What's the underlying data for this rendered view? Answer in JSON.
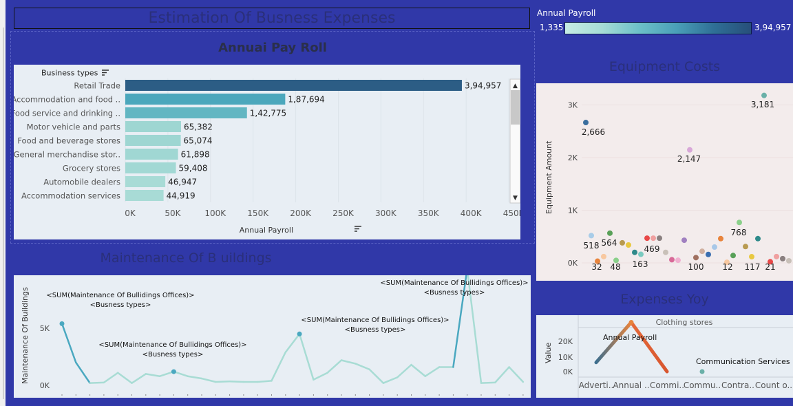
{
  "dashboard": {
    "title": "Estimation Of Busness Expenses"
  },
  "legend": {
    "title": "Annual Payroll",
    "min": "1,335",
    "max": "3,94,957"
  },
  "payroll": {
    "title": "Annuai Pay Roll",
    "row_header": "Business types",
    "axis_title": "Annual Payroll",
    "ticks": [
      "0K",
      "50K",
      "100K",
      "150K",
      "200K",
      "250K",
      "300K",
      "350K",
      "400K",
      "450K"
    ],
    "rows": [
      {
        "label": "Retail Trade",
        "value": 394957,
        "text": "3,94,957",
        "color": "#2c5d85"
      },
      {
        "label": "Accommodation and food ..",
        "value": 187694,
        "text": "1,87,694",
        "color": "#4ba7bc"
      },
      {
        "label": "Food service and drinking ..",
        "value": 142775,
        "text": "1,42,775",
        "color": "#62b6c2"
      },
      {
        "label": "Motor vehicle and parts",
        "value": 65382,
        "text": "65,382",
        "color": "#9ed6d2"
      },
      {
        "label": "Food and beverage stores",
        "value": 65074,
        "text": "65,074",
        "color": "#9ed6d2"
      },
      {
        "label": "General merchandise stor..",
        "value": 61898,
        "text": "61,898",
        "color": "#a0d7d3"
      },
      {
        "label": "Grocery stores",
        "value": 59408,
        "text": "59,408",
        "color": "#a2d8d4"
      },
      {
        "label": "Automobile dealers",
        "value": 46947,
        "text": "46,947",
        "color": "#a8dbd6"
      },
      {
        "label": "Accommodation services",
        "value": 44919,
        "text": "44,919",
        "color": "#a8dbd6"
      }
    ]
  },
  "maintenance": {
    "title": "Maintenance Of B uildings",
    "ylabel": "Maintenance Of Buildings",
    "yticks": [
      "5K",
      "0K"
    ],
    "annotation_line1": "<SUM(Maintenance Of Bullidings Offices)>",
    "annotation_line2": "<Busness types>"
  },
  "equipment": {
    "title": "Equipment Costs",
    "ylabel": "Equipment Amount",
    "yticks": [
      "3K",
      "2K",
      "1K",
      "0K"
    ],
    "labels": [
      "2,666",
      "3,181",
      "2,147",
      "518",
      "564",
      "469",
      "768",
      "163",
      "32",
      "48",
      "100",
      "12",
      "117",
      "21"
    ]
  },
  "yoy": {
    "title": "Expenses Yoy",
    "header": "Clothing stores",
    "ylabel": "Value",
    "yticks": [
      "20K",
      "10K",
      "0K"
    ],
    "categories": [
      "Adverti..",
      "Annual ..",
      "Commi..",
      "Commu..",
      "Contra..",
      "Count o.."
    ],
    "annotation_payroll": "Annual Payroll",
    "annotation_comm": "Communication Services"
  },
  "chart_data": [
    {
      "type": "bar",
      "title": "Annuai Pay Roll",
      "xlabel": "Annual Payroll",
      "ylabel": "Business types",
      "categories": [
        "Retail Trade",
        "Accommodation and food ..",
        "Food service and drinking ..",
        "Motor vehicle and parts",
        "Food and beverage stores",
        "General merchandise stor..",
        "Grocery stores",
        "Automobile dealers",
        "Accommodation services"
      ],
      "values": [
        394957,
        187694,
        142775,
        65382,
        65074,
        61898,
        59408,
        46947,
        44919
      ],
      "xlim": [
        0,
        450000
      ]
    },
    {
      "type": "line",
      "title": "Maintenance Of B uildings",
      "ylabel": "Maintenance Of Buildings",
      "values": [
        5400,
        2000,
        200,
        250,
        1100,
        200,
        1000,
        800,
        1200,
        800,
        600,
        300,
        350,
        300,
        300,
        400,
        2900,
        4500,
        500,
        1100,
        2200,
        1900,
        1400,
        200,
        700,
        1800,
        800,
        1600,
        1600,
        10200,
        200,
        250,
        1600,
        300
      ],
      "ylim": [
        0,
        10500
      ]
    },
    {
      "type": "scatter",
      "title": "Equipment Costs",
      "ylabel": "Equipment Amount",
      "values": [
        518,
        32,
        120,
        564,
        48,
        380,
        340,
        240,
        163,
        469,
        469,
        469,
        200,
        60,
        40,
        430,
        100,
        200,
        300,
        450,
        100,
        12,
        200,
        768,
        117,
        460,
        300,
        21,
        100,
        50,
        20
      ],
      "ylim": [
        0,
        3400
      ],
      "labeled_points": [
        2666,
        3181,
        2147,
        518,
        564,
        469,
        768,
        163,
        32,
        48,
        100,
        12,
        117,
        21
      ]
    },
    {
      "type": "line",
      "title": "Expenses Yoy",
      "ylabel": "Value",
      "categories": [
        "Adverti..",
        "Annual ..",
        "Commi..",
        "Commu..",
        "Contra..",
        "Count o.."
      ],
      "values": [
        5000,
        27000,
        0,
        0,
        0,
        0
      ],
      "ylim": [
        0,
        30000
      ]
    }
  ]
}
